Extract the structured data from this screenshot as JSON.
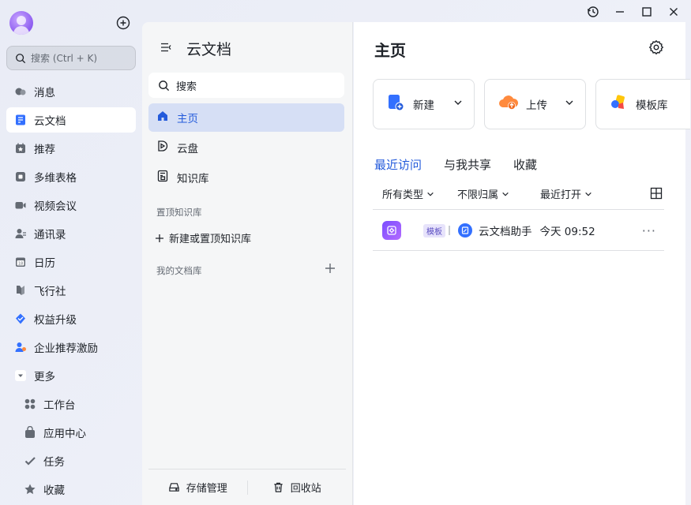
{
  "sidebar": {
    "search_placeholder": "搜索 (Ctrl + K)",
    "items": [
      {
        "label": "消息",
        "icon": "message-icon"
      },
      {
        "label": "云文档",
        "icon": "cloud-docs-icon",
        "active": true
      },
      {
        "label": "推荐",
        "icon": "recommend-icon"
      },
      {
        "label": "多维表格",
        "icon": "base-table-icon"
      },
      {
        "label": "视频会议",
        "icon": "video-meeting-icon"
      },
      {
        "label": "通讯录",
        "icon": "contacts-icon"
      },
      {
        "label": "日历",
        "icon": "calendar-icon"
      },
      {
        "label": "飞行社",
        "icon": "flight-club-icon"
      },
      {
        "label": "权益升级",
        "icon": "upgrade-icon"
      },
      {
        "label": "企业推荐激励",
        "icon": "referral-icon"
      },
      {
        "label": "更多",
        "icon": "more-toggle-icon"
      }
    ],
    "sub_items": [
      {
        "label": "工作台",
        "icon": "workplace-icon"
      },
      {
        "label": "应用中心",
        "icon": "app-center-icon"
      },
      {
        "label": "任务",
        "icon": "task-icon"
      },
      {
        "label": "收藏",
        "icon": "favorite-star-icon"
      }
    ]
  },
  "docs_panel": {
    "title": "云文档",
    "search_placeholder": "搜索",
    "items": [
      {
        "label": "主页",
        "icon": "home-icon",
        "active": true
      },
      {
        "label": "云盘",
        "icon": "cloud-drive-icon"
      },
      {
        "label": "知识库",
        "icon": "knowledge-base-icon"
      }
    ],
    "pinned_section": "置顶知识库",
    "add_pinned": "新建或置顶知识库",
    "my_library_section": "我的文档库",
    "footer": {
      "storage": "存储管理",
      "recycle": "回收站"
    }
  },
  "main": {
    "title": "主页",
    "actions": [
      {
        "label": "新建",
        "icon": "new-doc-icon"
      },
      {
        "label": "上传",
        "icon": "upload-icon"
      },
      {
        "label": "模板库",
        "icon": "template-icon"
      }
    ],
    "tabs": [
      {
        "label": "最近访问",
        "active": true
      },
      {
        "label": "与我共享"
      },
      {
        "label": "收藏"
      }
    ],
    "filters": [
      {
        "label": "所有类型"
      },
      {
        "label": "不限归属"
      },
      {
        "label": "最近打开"
      }
    ],
    "docs": [
      {
        "tag": "模板",
        "owner": "云文档助手",
        "time": "今天 09:52"
      }
    ]
  },
  "colors": {
    "accent": "#245bdb",
    "active_bg": "#d6dff5"
  }
}
